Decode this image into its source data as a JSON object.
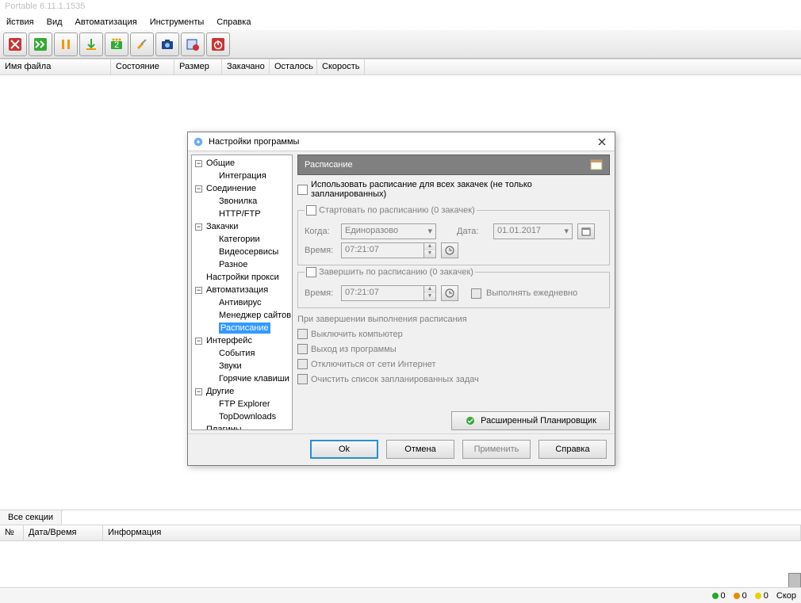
{
  "title": "Portable 6.11.1.1535",
  "menu": [
    "йствия",
    "Вид",
    "Автоматизация",
    "Инструменты",
    "Справка"
  ],
  "columns": {
    "filename": "Имя файла",
    "state": "Состояние",
    "size": "Размер",
    "downloaded": "Закачано",
    "remaining": "Осталось",
    "speed": "Скорость"
  },
  "tab_all": "Все секции",
  "log_cols": {
    "num": "№",
    "datetime": "Дата/Время",
    "info": "Информация"
  },
  "status": {
    "a": "0",
    "b": "0",
    "c": "0",
    "d": "Скор"
  },
  "dialog": {
    "title": "Настройки программы",
    "tree": {
      "general": "Общие",
      "integration": "Интеграция",
      "connection": "Соединение",
      "dialer": "Звонилка",
      "httpftp": "HTTP/FTP",
      "downloads": "Закачки",
      "categories": "Категории",
      "video": "Видеосервисы",
      "misc": "Разное",
      "proxy": "Настройки прокси",
      "automation": "Автоматизация",
      "antivirus": "Антивирус",
      "sitemgr": "Менеджер сайтов",
      "schedule": "Расписание",
      "interface": "Интерфейс",
      "events": "События",
      "sounds": "Звуки",
      "hotkeys": "Горячие клавиши",
      "other": "Другие",
      "ftp": "FTP Explorer",
      "topdl": "TopDownloads",
      "plugins": "Плагины"
    },
    "pane": {
      "header": "Расписание",
      "use_schedule": "Использовать расписание для всех закачек (не только запланированных)",
      "start_group": "Стартовать по расписанию  (0 закачек)",
      "when": "Когда:",
      "when_value": "Единоразово",
      "date": "Дата:",
      "date_value": "01.01.2017",
      "time": "Время:",
      "time_value": "07:21:07",
      "finish_group": "Завершить по расписанию  (0 закачек)",
      "daily": "Выполнять ежедневно",
      "on_finish": "При завершении выполнения расписания",
      "shutdown": "Выключить компьютер",
      "exit": "Выход из программы",
      "disconnect": "Отключиться от сети Интернет",
      "clear": "Очистить список запланированных задач",
      "advanced": "Расширенный Планировщик"
    },
    "buttons": {
      "ok": "Ok",
      "cancel": "Отмена",
      "apply": "Применить",
      "help": "Справка"
    }
  }
}
